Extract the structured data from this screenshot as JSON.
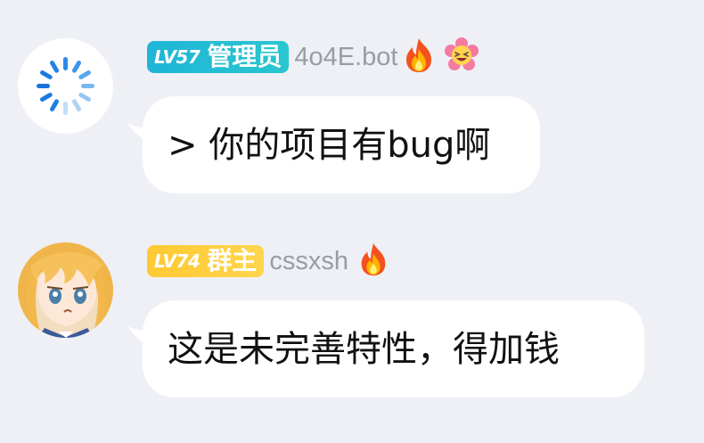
{
  "messages": [
    {
      "level": "LV57",
      "role": "管理员",
      "nickname": "4o4E.bot",
      "text": "> 你的项目有bug啊",
      "badge_color": "#1fb5d8",
      "avatar": "loading-spinner-icon",
      "title_icons": [
        "fire-icon",
        "flower-laughing-icon"
      ]
    },
    {
      "level": "LV74",
      "role": "群主",
      "nickname": "cssxsh",
      "text": "这是未完善特性，得加钱",
      "badge_color": "#ffc933",
      "avatar": "anime-girl-avatar",
      "title_icons": [
        "fire-icon"
      ]
    }
  ]
}
